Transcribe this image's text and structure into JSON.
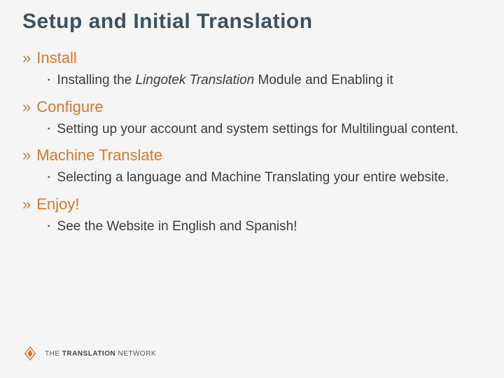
{
  "title": "Setup and Initial Translation",
  "sections": [
    {
      "title": "Install",
      "bullet_pre": "Installing the ",
      "bullet_italic": "Lingotek Translation",
      "bullet_post": " Module and Enabling it"
    },
    {
      "title": "Configure",
      "bullet": "Setting up your account and system settings for Multilingual content."
    },
    {
      "title": "Machine Translate",
      "bullet": "Selecting a language and Machine Translating your entire website."
    },
    {
      "title": "Enjoy!",
      "bullet": "See the Website in English and Spanish!"
    }
  ],
  "footer": {
    "pre": "THE ",
    "bold": "TRANSLATION",
    "post": " NETWORK"
  },
  "glyphs": {
    "chevron": "»",
    "square": "▪"
  }
}
